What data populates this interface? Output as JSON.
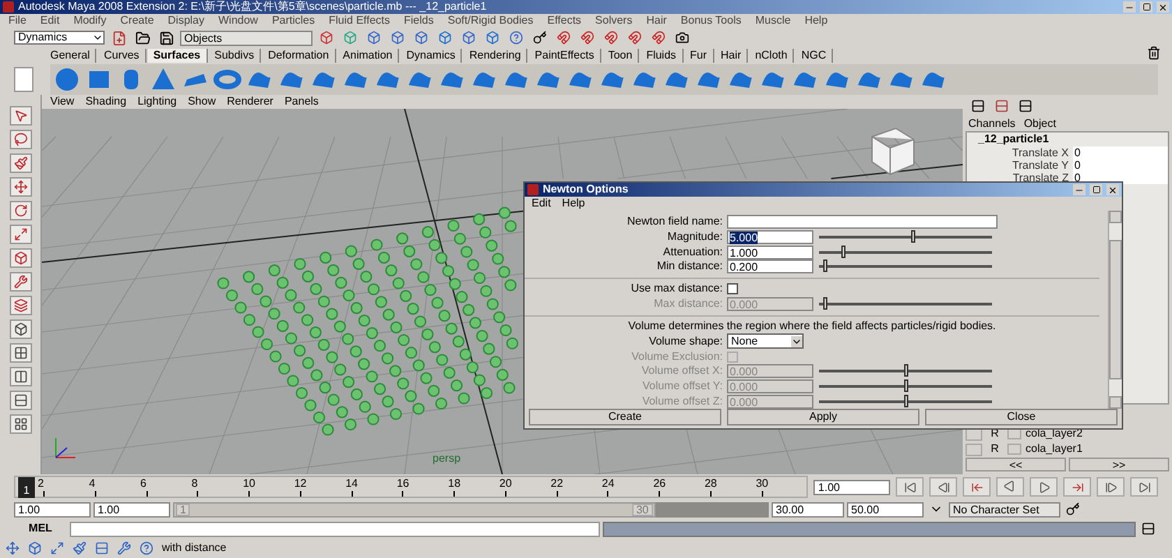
{
  "window": {
    "title": "Autodesk Maya 2008 Extension 2: E:\\新子\\光盘文件\\第5章\\scenes\\particle.mb  ---  _12_particle1"
  },
  "menu": [
    "File",
    "Edit",
    "Modify",
    "Create",
    "Display",
    "Window",
    "Particles",
    "Fluid Effects",
    "Fields",
    "Soft/Rigid Bodies",
    "Effects",
    "Solvers",
    "Hair",
    "Bonus Tools",
    "Muscle",
    "Help"
  ],
  "status_line": {
    "menu_set": "Dynamics",
    "selection_field": "Objects"
  },
  "shelf_tabs": [
    {
      "label": "General",
      "selected": false
    },
    {
      "label": "Curves",
      "selected": false
    },
    {
      "label": "Surfaces",
      "selected": true
    },
    {
      "label": "Subdivs",
      "selected": false
    },
    {
      "label": "Deformation",
      "selected": false
    },
    {
      "label": "Animation",
      "selected": false
    },
    {
      "label": "Dynamics",
      "selected": false
    },
    {
      "label": "Rendering",
      "selected": false
    },
    {
      "label": "PaintEffects",
      "selected": false
    },
    {
      "label": "Toon",
      "selected": false
    },
    {
      "label": "Fluids",
      "selected": false
    },
    {
      "label": "Fur",
      "selected": false
    },
    {
      "label": "Hair",
      "selected": false
    },
    {
      "label": "nCloth",
      "selected": false
    },
    {
      "label": "NGC",
      "selected": false
    }
  ],
  "viewport": {
    "menu": [
      "View",
      "Shading",
      "Lighting",
      "Show",
      "Renderer",
      "Panels"
    ],
    "camera_label": "persp"
  },
  "channel_box": {
    "tabs": [
      "Channels",
      "Object"
    ],
    "object": "_12_particle1",
    "channels": [
      {
        "name": "Translate X",
        "value": "0"
      },
      {
        "name": "Translate Y",
        "value": "0"
      },
      {
        "name": "Translate Z",
        "value": "0"
      }
    ]
  },
  "layers": [
    {
      "flag": "R",
      "name": "cola_layer2"
    },
    {
      "flag": "R",
      "name": "cola_layer1"
    }
  ],
  "layer_nav": [
    "<<",
    ">>"
  ],
  "dialog": {
    "title": "Newton Options",
    "menu": [
      "Edit",
      "Help"
    ],
    "rows": [
      {
        "kind": "text",
        "label": "Newton field name:",
        "disabled": false
      },
      {
        "kind": "slider",
        "label": "Magnitude:",
        "value": "5.000",
        "level": 0.54,
        "disabled": false,
        "value_selected": true
      },
      {
        "kind": "slider",
        "label": "Attenuation:",
        "value": "1.000",
        "level": 0.14,
        "disabled": false,
        "value_selected": false
      },
      {
        "kind": "slider",
        "label": "Min distance:",
        "value": "0.200",
        "level": 0.03,
        "disabled": false,
        "value_selected": false
      },
      {
        "kind": "separator"
      },
      {
        "kind": "checkbox",
        "label": "Use max distance:",
        "checked": false,
        "disabled": false
      },
      {
        "kind": "slider",
        "label": "Max distance:",
        "value": "0.000",
        "level": 0.03,
        "disabled": true,
        "value_selected": false
      },
      {
        "kind": "separator"
      },
      {
        "kind": "note",
        "label": "Volume determines the region where the field affects particles/rigid bodies."
      },
      {
        "kind": "dropdown",
        "label": "Volume shape:",
        "value": "None",
        "disabled": false
      },
      {
        "kind": "checkbox",
        "label": "Volume Exclusion:",
        "checked": false,
        "disabled": true
      },
      {
        "kind": "slider",
        "label": "Volume offset X:",
        "value": "0.000",
        "level": 0.5,
        "disabled": true,
        "value_selected": false
      },
      {
        "kind": "slider",
        "label": "Volume offset Y:",
        "value": "0.000",
        "level": 0.5,
        "disabled": true,
        "value_selected": false
      },
      {
        "kind": "slider",
        "label": "Volume offset Z:",
        "value": "0.000",
        "level": 0.5,
        "disabled": true,
        "value_selected": false
      }
    ],
    "buttons": [
      "Create",
      "Apply",
      "Close"
    ]
  },
  "time_slider": {
    "current_frame": "1",
    "level": 0,
    "labels": [
      "2",
      "4",
      "6",
      "8",
      "10",
      "12",
      "14",
      "16",
      "18",
      "20",
      "22",
      "24",
      "26",
      "28",
      "30"
    ],
    "current_time": "1.00"
  },
  "range_slider": {
    "start": "1.00",
    "inner_start": "1.00",
    "handle_start": "1",
    "handle_end": "30",
    "level": 0.81,
    "inner_end": "30.00",
    "end": "50.00",
    "character_set": "No Character Set"
  },
  "command_line": {
    "label": "MEL"
  },
  "help_line": "with distance"
}
